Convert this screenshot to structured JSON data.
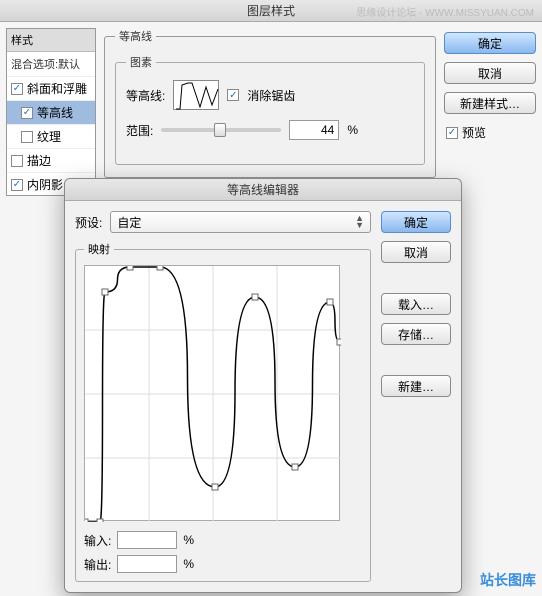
{
  "window": {
    "title": "图层样式"
  },
  "watermarks": {
    "top_text": "思缘设计论坛 - WWW.MISSYUAN.COM",
    "bottom_text": "站长图库"
  },
  "sidebar": {
    "header": "样式",
    "blend_options": "混合选项:默认",
    "items": [
      {
        "label": "斜面和浮雕",
        "checked": true,
        "selected": false,
        "indent": false
      },
      {
        "label": "等高线",
        "checked": true,
        "selected": true,
        "indent": true
      },
      {
        "label": "纹理",
        "checked": false,
        "selected": false,
        "indent": true
      },
      {
        "label": "描边",
        "checked": false,
        "selected": false,
        "indent": false
      },
      {
        "label": "内阴影",
        "checked": true,
        "selected": false,
        "indent": false
      }
    ]
  },
  "contour_panel": {
    "group_label": "等高线",
    "elements_label": "图素",
    "contour_label": "等高线:",
    "antialias_label": "消除锯齿",
    "antialias_checked": true,
    "range_label": "范围:",
    "range_value": "44",
    "range_unit": "%"
  },
  "buttons_right": {
    "ok": "确定",
    "cancel": "取消",
    "new_style": "新建样式…",
    "preview": "预览",
    "preview_checked": true
  },
  "editor": {
    "title": "等高线编辑器",
    "preset_label": "预设:",
    "preset_value": "自定",
    "mapping_label": "映射",
    "input_label": "输入:",
    "input_value": "",
    "output_label": "输出:",
    "output_value": "",
    "unit": "%",
    "buttons": {
      "ok": "确定",
      "cancel": "取消",
      "load": "载入…",
      "save": "存储…",
      "new": "新建…"
    }
  },
  "chart_data": {
    "type": "line",
    "title": "映射",
    "xlabel": "输入",
    "ylabel": "输出",
    "xlim": [
      0,
      255
    ],
    "ylim": [
      0,
      255
    ],
    "points": [
      {
        "x": 0,
        "y": 0
      },
      {
        "x": 15,
        "y": 0
      },
      {
        "x": 20,
        "y": 230
      },
      {
        "x": 45,
        "y": 255
      },
      {
        "x": 75,
        "y": 255
      },
      {
        "x": 130,
        "y": 35
      },
      {
        "x": 170,
        "y": 225
      },
      {
        "x": 210,
        "y": 55
      },
      {
        "x": 245,
        "y": 220
      },
      {
        "x": 255,
        "y": 180
      }
    ]
  }
}
